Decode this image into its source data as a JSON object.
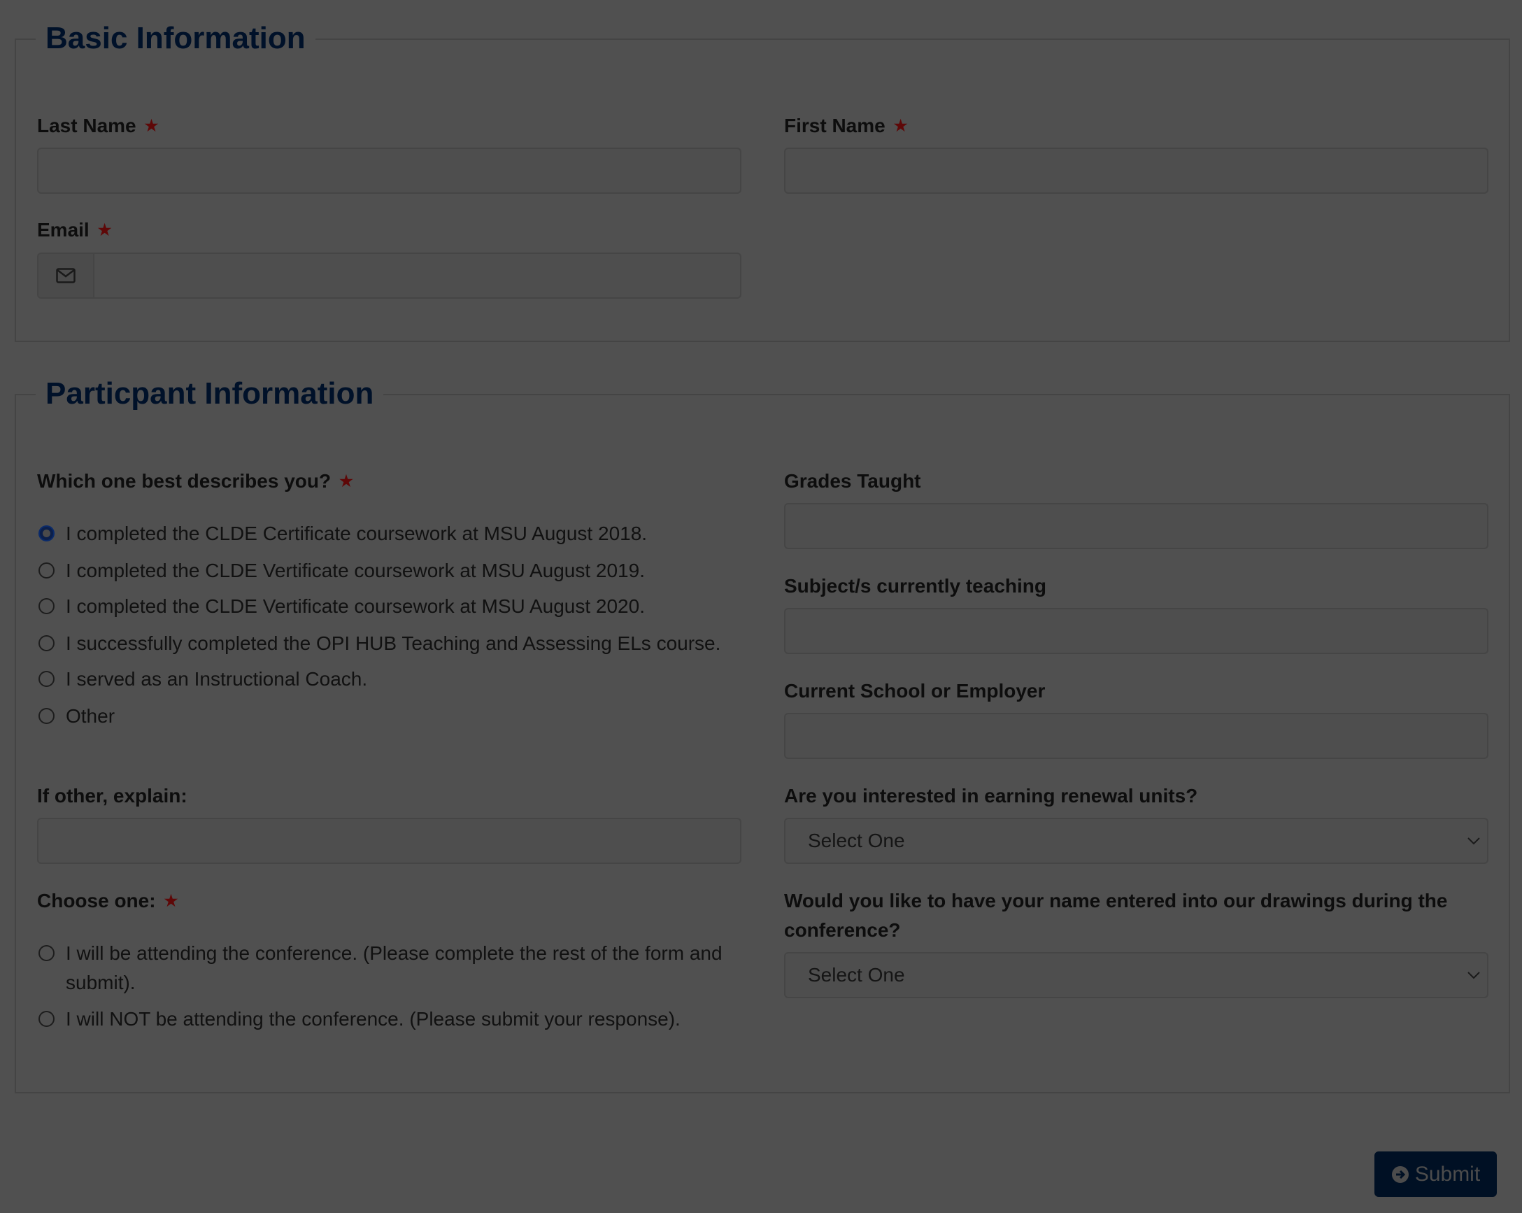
{
  "basic": {
    "legend": "Basic Information",
    "last_name_label": "Last Name",
    "first_name_label": "First Name",
    "email_label": "Email",
    "required_mark": "★"
  },
  "participant": {
    "legend": "Particpant Information",
    "describe_label": "Which one best describes you?",
    "describe_options": [
      {
        "label": "I completed the CLDE Certificate coursework at MSU August 2018.",
        "checked": true
      },
      {
        "label": "I completed the CLDE Vertificate coursework at MSU August 2019.",
        "checked": false
      },
      {
        "label": "I completed the CLDE Vertificate coursework at MSU August 2020.",
        "checked": false
      },
      {
        "label": "I successfully completed the OPI HUB Teaching and Assessing ELs course.",
        "checked": false
      },
      {
        "label": "I served as an Instructional Coach.",
        "checked": false
      },
      {
        "label": "Other",
        "checked": false
      }
    ],
    "other_label": "If other, explain:",
    "choose_label": "Choose one:",
    "choose_options": [
      {
        "label": "I will be attending the conference. (Please complete the rest of the form and submit).",
        "checked": false
      },
      {
        "label": "I will NOT be attending the conference. (Please submit your response).",
        "checked": false
      }
    ],
    "grades_label": "Grades Taught",
    "subjects_label": "Subject/s currently teaching",
    "school_label": "Current School or Employer",
    "renewal_label": "Are you interested in earning renewal units?",
    "renewal_value": "Select One",
    "drawings_label": "Would you like to have your name entered into our drawings during the conference?",
    "drawings_value": "Select One"
  },
  "submit_label": "Submit",
  "colors": {
    "legend": "#001129",
    "required": "#5e0808",
    "submit_bg": "#001024",
    "overlay": "#505050"
  },
  "icons": {
    "email": "envelope-icon",
    "submit": "arrow-circle-right-icon",
    "select": "chevron-down-icon"
  }
}
